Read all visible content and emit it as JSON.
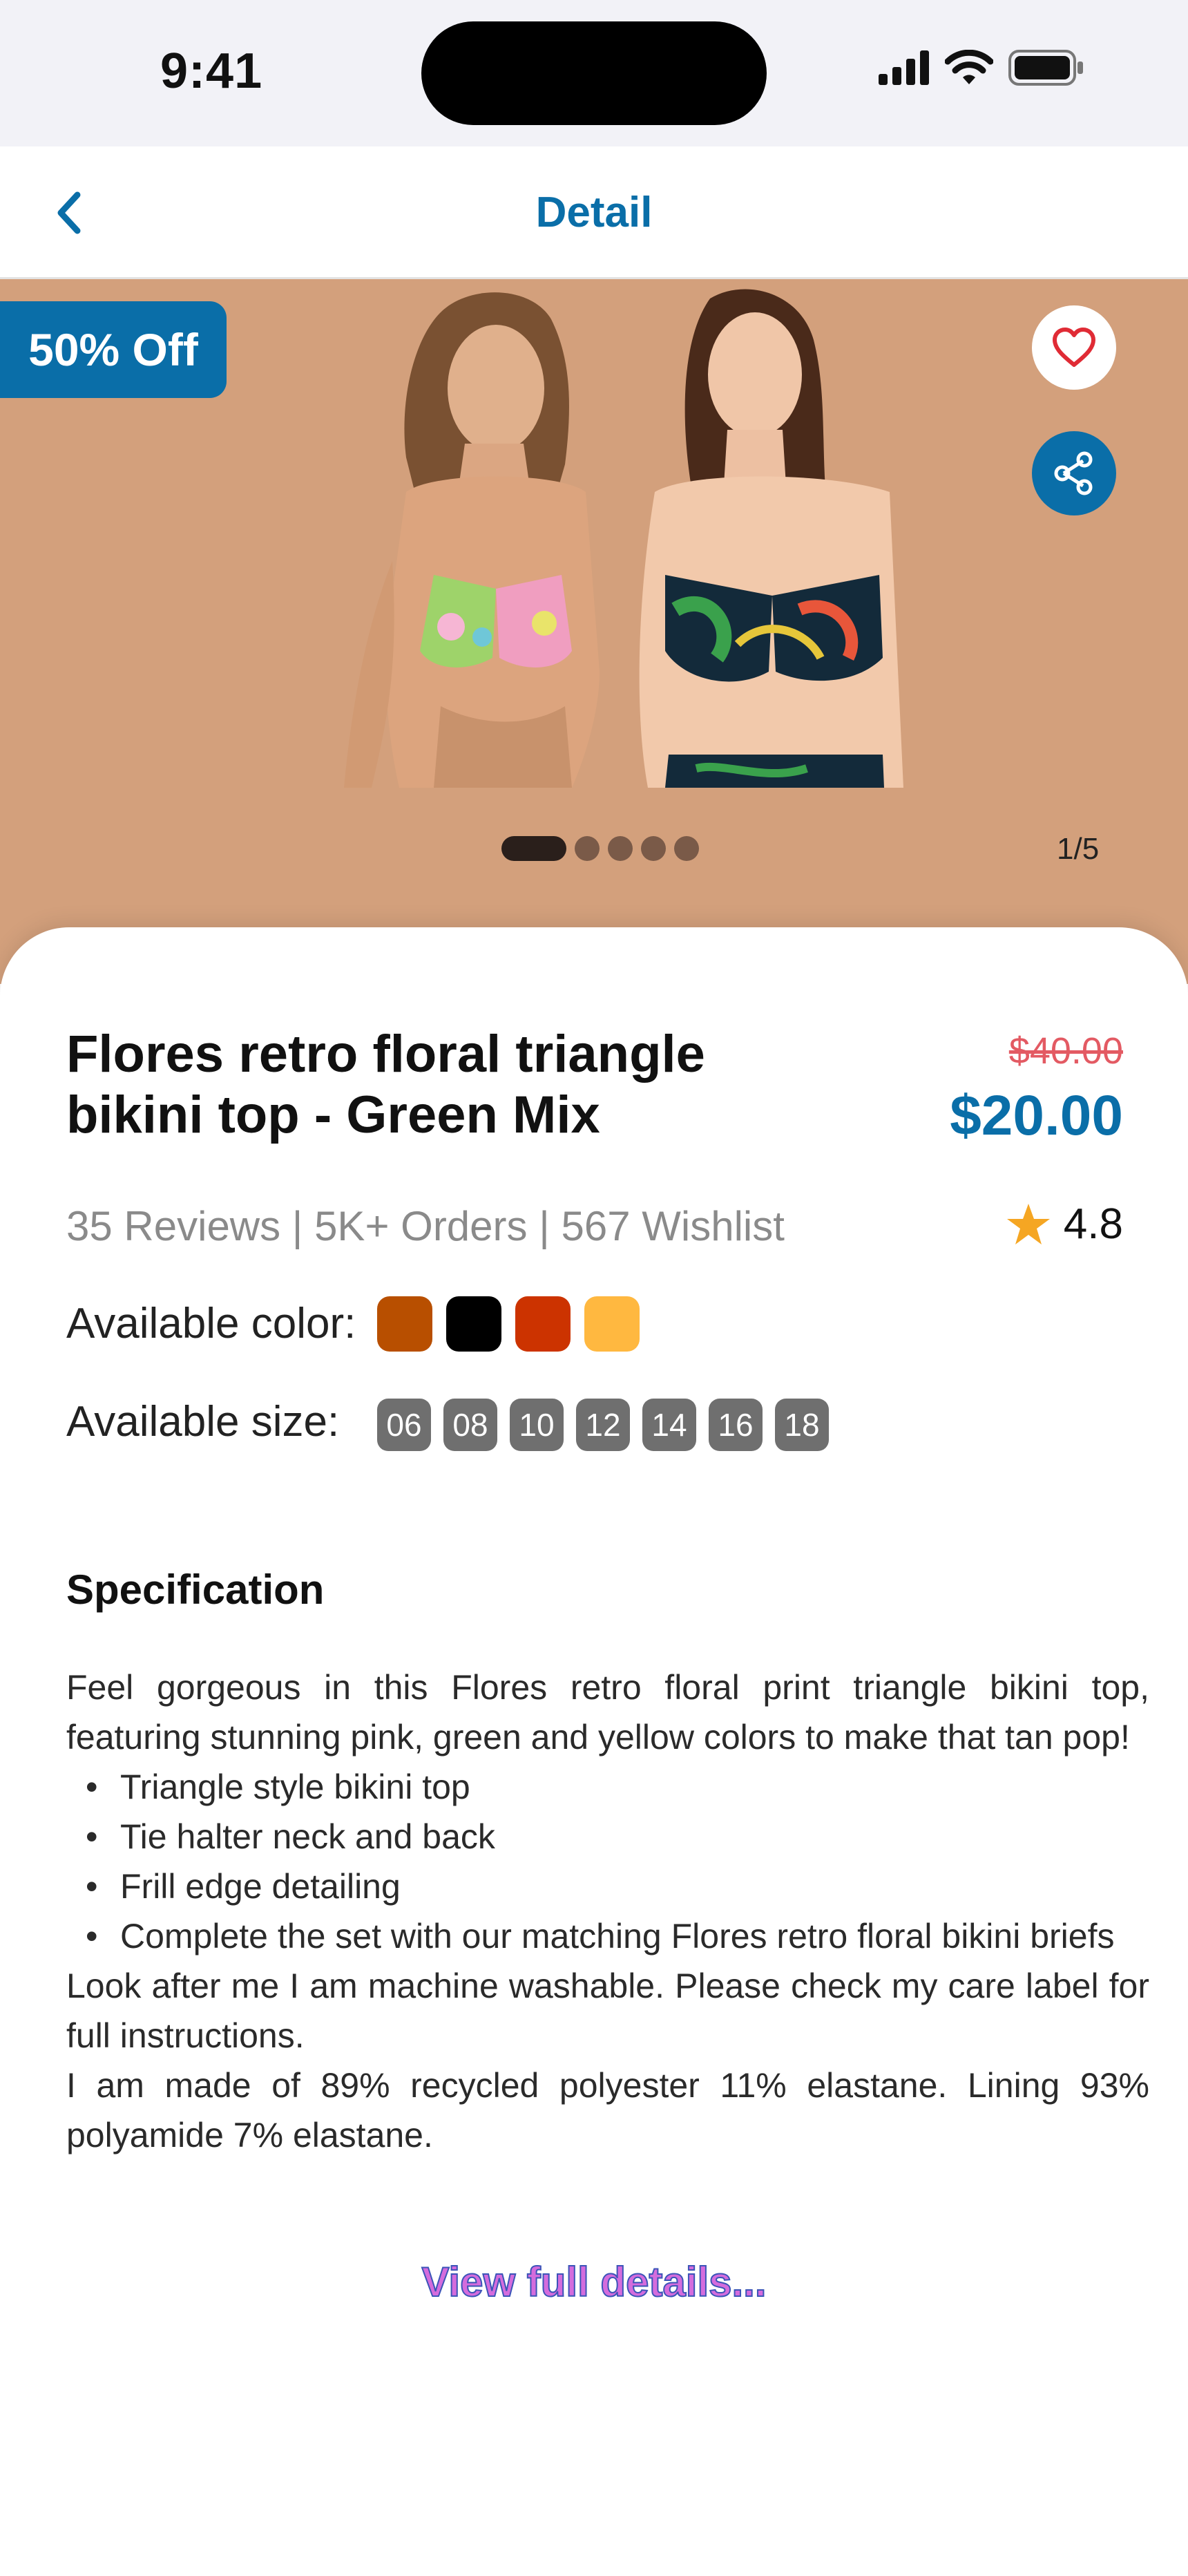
{
  "status_bar": {
    "time": "9:41"
  },
  "nav": {
    "title": "Detail"
  },
  "hero": {
    "discount_badge": "50% Off",
    "image_counter": "1/5",
    "pager": {
      "count": 5,
      "active_index": 0
    },
    "background_color": "#d3a07c"
  },
  "product": {
    "title": "Flores retro floral triangle bikini top - Green Mix",
    "old_price": "$40.00",
    "new_price": "$20.00",
    "stats": "35 Reviews | 5K+ Orders | 567 Wishlist",
    "rating": "4.8",
    "color_label": "Available color:",
    "colors": [
      "#b84f00",
      "#000000",
      "#cc3300",
      "#ffb840"
    ],
    "size_label": "Available size:",
    "sizes": [
      "06",
      "08",
      "10",
      "12",
      "14",
      "16",
      "18"
    ]
  },
  "specification": {
    "heading": "Specification",
    "intro": "Feel gorgeous in this Flores retro floral print triangle bikini top, featuring stunning pink, green and yellow colors to make that tan pop!",
    "bullets": [
      "Triangle style bikini top",
      "Tie halter neck and back",
      "Frill edge detailing",
      "Complete the set with our matching Flores retro floral bikini briefs"
    ],
    "care": "Look after me I am machine washable. Please check my care label for full instructions.",
    "material": "I am made of 89% recycled polyester 11% elastane. Lining 93% polyamide 7% elastane.",
    "view_more": "View full details..."
  },
  "colors": {
    "accent": "#0a6ea8",
    "old_price": "#e35a63",
    "star": "#f5a623"
  }
}
